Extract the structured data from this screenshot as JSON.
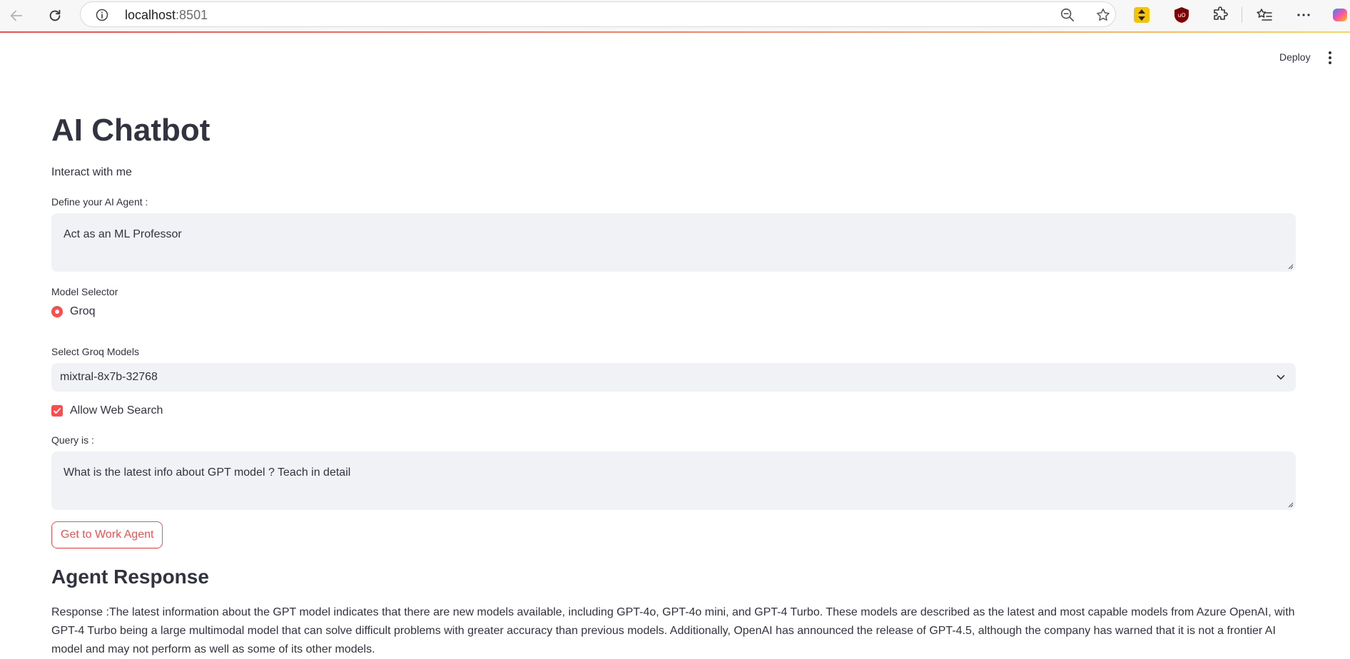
{
  "browser": {
    "url_host": "localhost",
    "url_port": ":8501",
    "icons": [
      "back-icon",
      "reload-icon",
      "site-info-icon",
      "zoom-out-icon",
      "favorite-star-icon",
      "extension-yellow-icon",
      "ublock-icon",
      "extensions-puzzle-icon",
      "favorites-list-icon",
      "more-menu-icon",
      "copilot-icon"
    ]
  },
  "header": {
    "deploy_label": "Deploy"
  },
  "main": {
    "title": "AI Chatbot",
    "subtitle": "Interact with me",
    "agent": {
      "label": "Define your AI Agent :",
      "value": "Act as an ML Professor"
    },
    "model_selector": {
      "label": "Model Selector",
      "options": [
        "Groq"
      ],
      "selected": "Groq"
    },
    "groq_models": {
      "label": "Select Groq Models",
      "selected": "mixtral-8x7b-32768"
    },
    "web_search": {
      "label": "Allow Web Search",
      "checked": true
    },
    "query": {
      "label": "Query is :",
      "value": "What is the latest info about GPT model ? Teach in detail"
    },
    "submit_label": "Get to Work Agent",
    "response_title": "Agent Response",
    "response_text": "Response :The latest information about the GPT model indicates that there are new models available, including GPT-4o, GPT-4o mini, and GPT-4 Turbo. These models are described as the latest and most capable models from Azure OpenAI, with GPT-4 Turbo being a large multimodal model that can solve difficult problems with greater accuracy than previous models. Additionally, OpenAI has announced the release of GPT-4.5, although the company has warned that it is not a frontier AI model and may not perform as well as some of its other models."
  },
  "colors": {
    "accent": "#ff4b4b",
    "input_bg": "#f0f2f6",
    "text": "#31333f"
  }
}
